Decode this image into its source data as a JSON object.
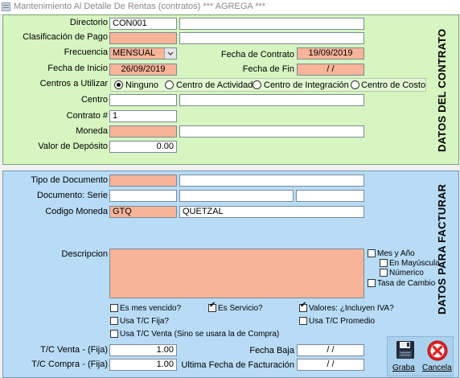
{
  "window": {
    "title": "Mantenimiento Al Detalle De Rentas (contratos)   *** AGREGA ***"
  },
  "sections": {
    "contrato": "DATOS DEL CONTRATO",
    "facturar": "DATOS PARA FACTURAR"
  },
  "contrato": {
    "directorio_label": "Directorio",
    "directorio_value": "CON001",
    "clasificacion_label": "Clasificación de Pago",
    "frecuencia_label": "Frecuencia",
    "frecuencia_value": "MENSUAL",
    "fecha_contrato_label": "Fecha de Contrato",
    "fecha_contrato_value": "19/09/2019",
    "fecha_inicio_label": "Fecha de Inicio",
    "fecha_inicio_value": "26/09/2019",
    "fecha_fin_label": "Fecha de Fin",
    "fecha_fin_value": "/ /",
    "centros_label": "Centros a Utilizar",
    "centros_options": [
      "Ninguno",
      "Centro de Actividad",
      "Centro de Integración",
      "Centro de Costo"
    ],
    "centro_label": "Centro",
    "contrato_num_label": "Contrato #",
    "contrato_num_value": "1",
    "moneda_label": "Moneda",
    "valor_deposito_label": "Valor de Depósito",
    "valor_deposito_value": "0.00"
  },
  "facturar": {
    "tipo_doc_label": "Tipo de Documento",
    "documento_label": "Documento:  Serie",
    "codigo_moneda_label": "Codigo Moneda",
    "codigo_moneda_value": "GTQ",
    "moneda_nombre": "QUETZAL",
    "descripcion_label": "Descripcion",
    "mes_anio": "Mes y Año",
    "en_mayuscula": "En Mayúscula",
    "numerico": "Númerico",
    "tasa_cambio": "Tasa de Cambio",
    "es_mes_vencido": "Es mes vencido?",
    "es_servicio": "Es Servicio?",
    "valores_iva": "Valores: ¿Incluyen IVA?",
    "usa_tc_fija": "Usa T/C Fija?",
    "usa_tc_promedio": "Usa T/C Promedio",
    "usa_tc_venta": "Usa T/C Venta (Sino se usara la de Compra)",
    "tc_venta_label": "T/C Venta - (Fija)",
    "tc_venta_value": "1.00",
    "tc_compra_label": "T/C Compra - (Fija)",
    "tc_compra_value": "1.00",
    "fecha_baja_label": "Fecha Baja",
    "fecha_baja_value": "/ /",
    "ultima_fecha_label": "Ultima Fecha de Facturación",
    "ultima_fecha_value": "/ /"
  },
  "buttons": {
    "graba": "Graba",
    "cancela": "Cancela"
  },
  "colors": {
    "green_panel": "#d6f5c0",
    "blue_panel": "#b8dcf6",
    "required_field": "#f7b498"
  }
}
